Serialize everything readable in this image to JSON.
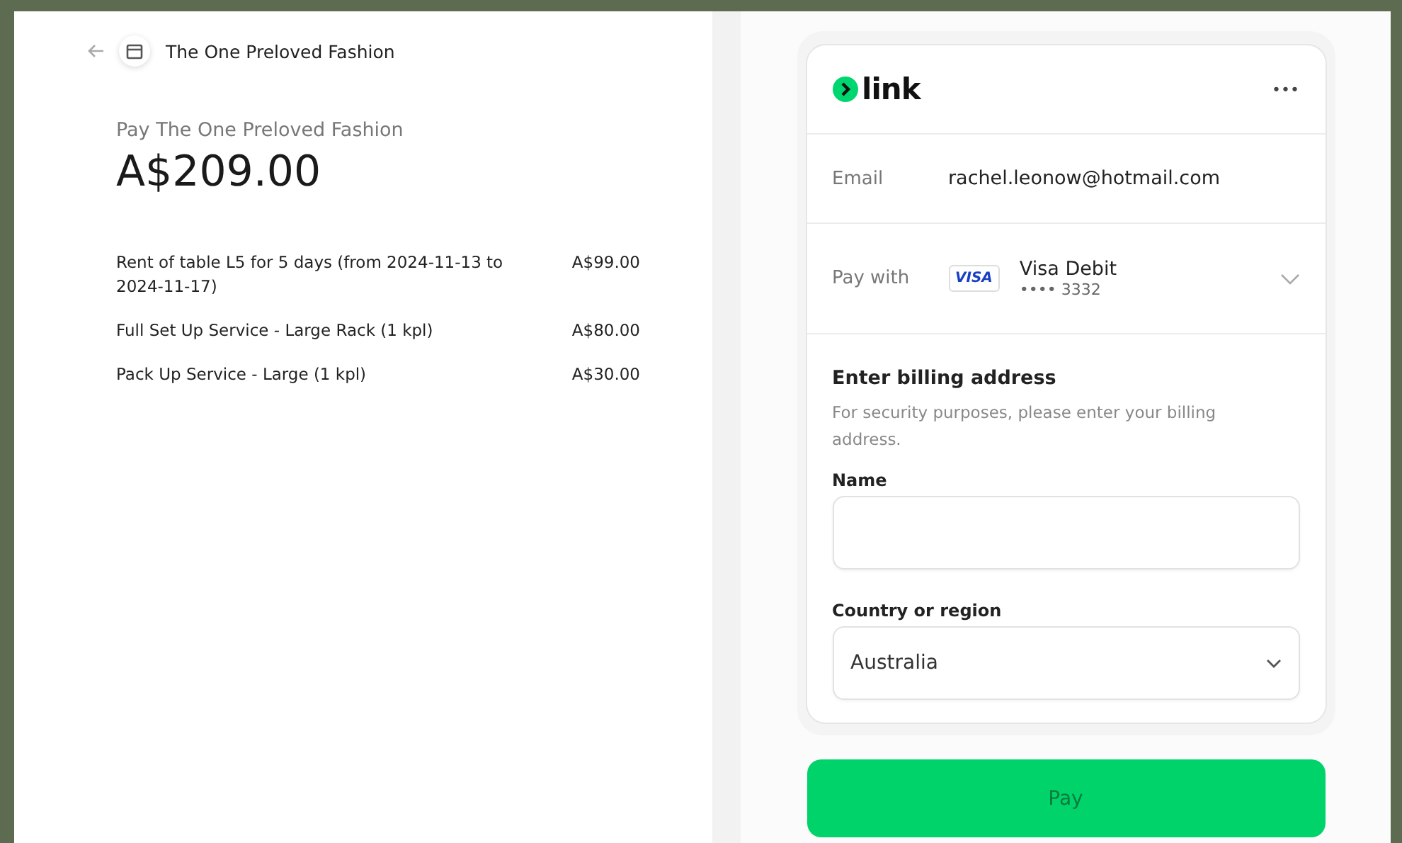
{
  "merchant": {
    "name": "The One Preloved Fashion"
  },
  "summary": {
    "label": "Pay The One Preloved Fashion",
    "amount": "A$209.00"
  },
  "items": [
    {
      "description": "Rent of table L5 for 5 days (from 2024-11-13 to 2024-11-17)",
      "price": "A$99.00"
    },
    {
      "description": "Full Set Up Service - Large Rack (1 kpl)",
      "price": "A$80.00"
    },
    {
      "description": "Pack Up Service - Large (1 kpl)",
      "price": "A$30.00"
    }
  ],
  "link_card": {
    "brand": "link",
    "menu": "•••",
    "email": {
      "label": "Email",
      "value": "rachel.leonow@hotmail.com"
    },
    "payment": {
      "label": "Pay with",
      "card_brand": "VISA",
      "card_name": "Visa Debit",
      "card_number": "•••• 3332"
    },
    "billing": {
      "title": "Enter billing address",
      "note": "For security purposes, please enter your billing address.",
      "name_field": {
        "label": "Name"
      },
      "country_field": {
        "label": "Country or region",
        "value": "Australia"
      }
    }
  },
  "pay_button": {
    "label": "Pay",
    "disabled": true
  }
}
